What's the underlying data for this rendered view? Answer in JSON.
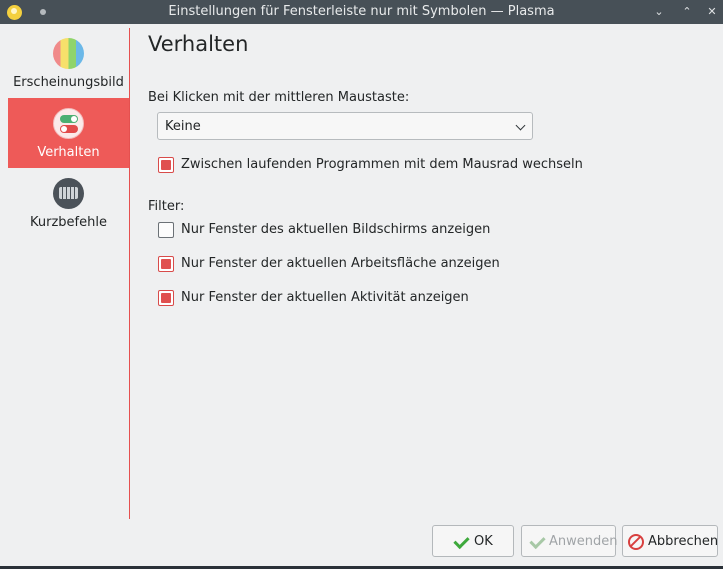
{
  "window": {
    "title": "Einstellungen für Fensterleiste nur mit Symbolen — Plasma",
    "icons": [
      "app-icon",
      "pin-icon",
      "minimize-icon",
      "maximize-icon",
      "close-icon"
    ]
  },
  "sidebar": {
    "items": [
      {
        "label": "Erscheinungsbild",
        "icon": "appearance-icon",
        "active": false
      },
      {
        "label": "Verhalten",
        "icon": "behavior-icon",
        "active": true
      },
      {
        "label": "Kurzbefehle",
        "icon": "keyboard-icon",
        "active": false
      }
    ]
  },
  "page": {
    "title": "Verhalten",
    "middle_click_label": "Bei Klicken mit der mittleren Maustaste:",
    "middle_click_value": "Keine",
    "wheel_switch": {
      "label": "Zwischen laufenden Programmen mit dem Mausrad wechseln",
      "checked": true
    },
    "filter_label": "Filter:",
    "filters": [
      {
        "label": "Nur Fenster des aktuellen Bildschirms anzeigen",
        "checked": false
      },
      {
        "label": "Nur Fenster der aktuellen Arbeitsfläche anzeigen",
        "checked": true
      },
      {
        "label": "Nur Fenster der aktuellen Aktivität anzeigen",
        "checked": true
      }
    ]
  },
  "buttons": {
    "ok": "OK",
    "apply": "Anwenden",
    "cancel": "Abbrechen"
  },
  "colors": {
    "accent": "#ee5a58",
    "titlebar": "#475057",
    "window_bg": "#eff0f1"
  }
}
